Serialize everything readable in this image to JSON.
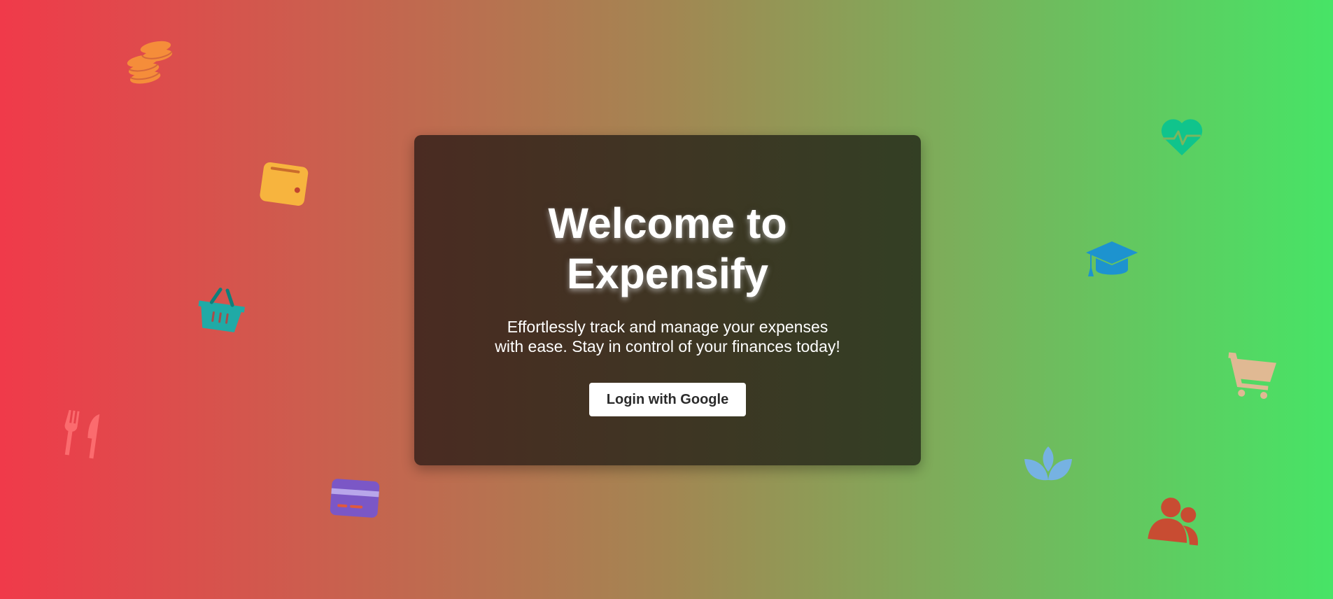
{
  "page": {
    "gradient_start": "#f03a4a",
    "gradient_mid": "#a38652",
    "gradient_end": "#47e466"
  },
  "card": {
    "title": "Welcome to Expensify",
    "subtitle": "Effortlessly track and manage your expenses with ease. Stay in control of your finances today!",
    "login_label": "Login with Google",
    "gradient_start": "#4a2b22",
    "gradient_end": "#333f24"
  },
  "decorations": [
    {
      "icon": "coins-icon",
      "color": "#f58d3a"
    },
    {
      "icon": "wallet-icon",
      "color": "#f7b43e"
    },
    {
      "icon": "shopping-basket-icon",
      "color": "#20aaa6"
    },
    {
      "icon": "utensils-icon",
      "color": "#fb6b6e"
    },
    {
      "icon": "credit-card-icon",
      "color": "#7b57c6"
    },
    {
      "icon": "heart-pulse-icon",
      "color": "#10c48c"
    },
    {
      "icon": "graduation-cap-icon",
      "color": "#1d93cf"
    },
    {
      "icon": "shopping-cart-icon",
      "color": "#e0b993"
    },
    {
      "icon": "spa-icon",
      "color": "#76b2e2"
    },
    {
      "icon": "users-icon",
      "color": "#c84c32"
    }
  ]
}
